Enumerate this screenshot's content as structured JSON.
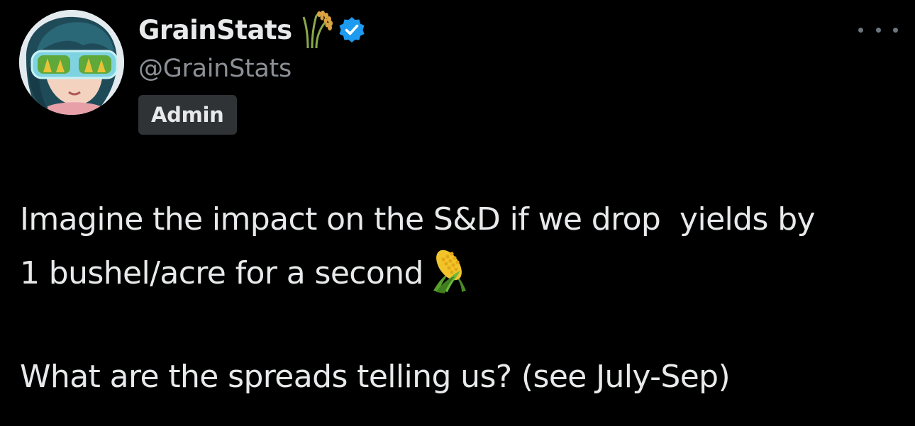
{
  "author": {
    "display_name": "GrainStats",
    "handle": "@GrainStats",
    "badge": "Admin",
    "name_icon": "rice-sheaf-icon",
    "verified_icon": "verified-badge-icon"
  },
  "menu": {
    "more_icon": "more-options-icon"
  },
  "tweet": {
    "line1": "Imagine the impact on the S&D if we drop  yields by",
    "line2": "1 bushel/acre for a second",
    "line2_emoji": "corn-icon",
    "line3": "What are the spreads telling us? (see July-Sep)"
  },
  "colors": {
    "background": "#000000",
    "text_primary": "#e7e9ea",
    "text_secondary": "#8b9096",
    "badge_bg": "#2f3336",
    "verified_blue": "#1d9bf0"
  }
}
